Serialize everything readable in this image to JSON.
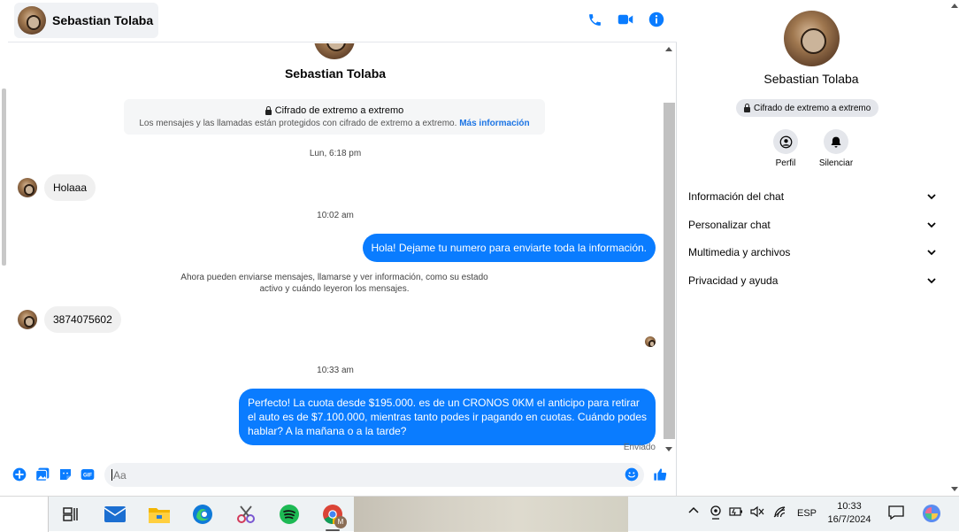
{
  "contact": {
    "name": "Sebastian Tolaba"
  },
  "header": {
    "icons": [
      "phone-icon",
      "video-icon",
      "info-icon"
    ]
  },
  "encryption": {
    "title": "Cifrado de extremo a extremo",
    "subtitle": "Los mensajes y las llamadas están protegidos con cifrado de extremo a extremo.",
    "link": "Más información"
  },
  "messages": [
    {
      "type": "timestamp",
      "text": "Lun, 6:18 pm"
    },
    {
      "type": "incoming",
      "text": "Holaaa"
    },
    {
      "type": "timestamp",
      "text": "10:02 am"
    },
    {
      "type": "outgoing",
      "text": "Hola! Dejame tu numero  para enviarte toda la información."
    },
    {
      "type": "info",
      "text": "Ahora pueden enviarse mensajes, llamarse y ver información, como su estado activo y cuándo leyeron los mensajes."
    },
    {
      "type": "incoming",
      "text": "3874075602"
    },
    {
      "type": "timestamp",
      "text": "10:33 am"
    },
    {
      "type": "outgoing",
      "text": "Perfecto! La cuota desde $195.000. es de un CRONOS 0KM el anticipo para retirar el auto es de $7.100.000, mientras tanto podes ir pagando en cuotas. Cuándo podes hablar? A la mañana o a la tarde?"
    }
  ],
  "status": {
    "sent": "Enviado"
  },
  "composer": {
    "placeholder": "Aa"
  },
  "sidebar": {
    "e2e_badge": "Cifrado de extremo a extremo",
    "actions": [
      {
        "label": "Perfil"
      },
      {
        "label": "Silenciar"
      }
    ],
    "sections": [
      {
        "label": "Información del chat"
      },
      {
        "label": "Personalizar chat"
      },
      {
        "label": "Multimedia y archivos"
      },
      {
        "label": "Privacidad y ayuda"
      }
    ]
  },
  "taskbar": {
    "language": "ESP",
    "time": "10:33",
    "date": "16/7/2024",
    "chrome_profile_letter": "M"
  },
  "colors": {
    "accent": "#0a7cff",
    "link": "#1b74e4"
  }
}
